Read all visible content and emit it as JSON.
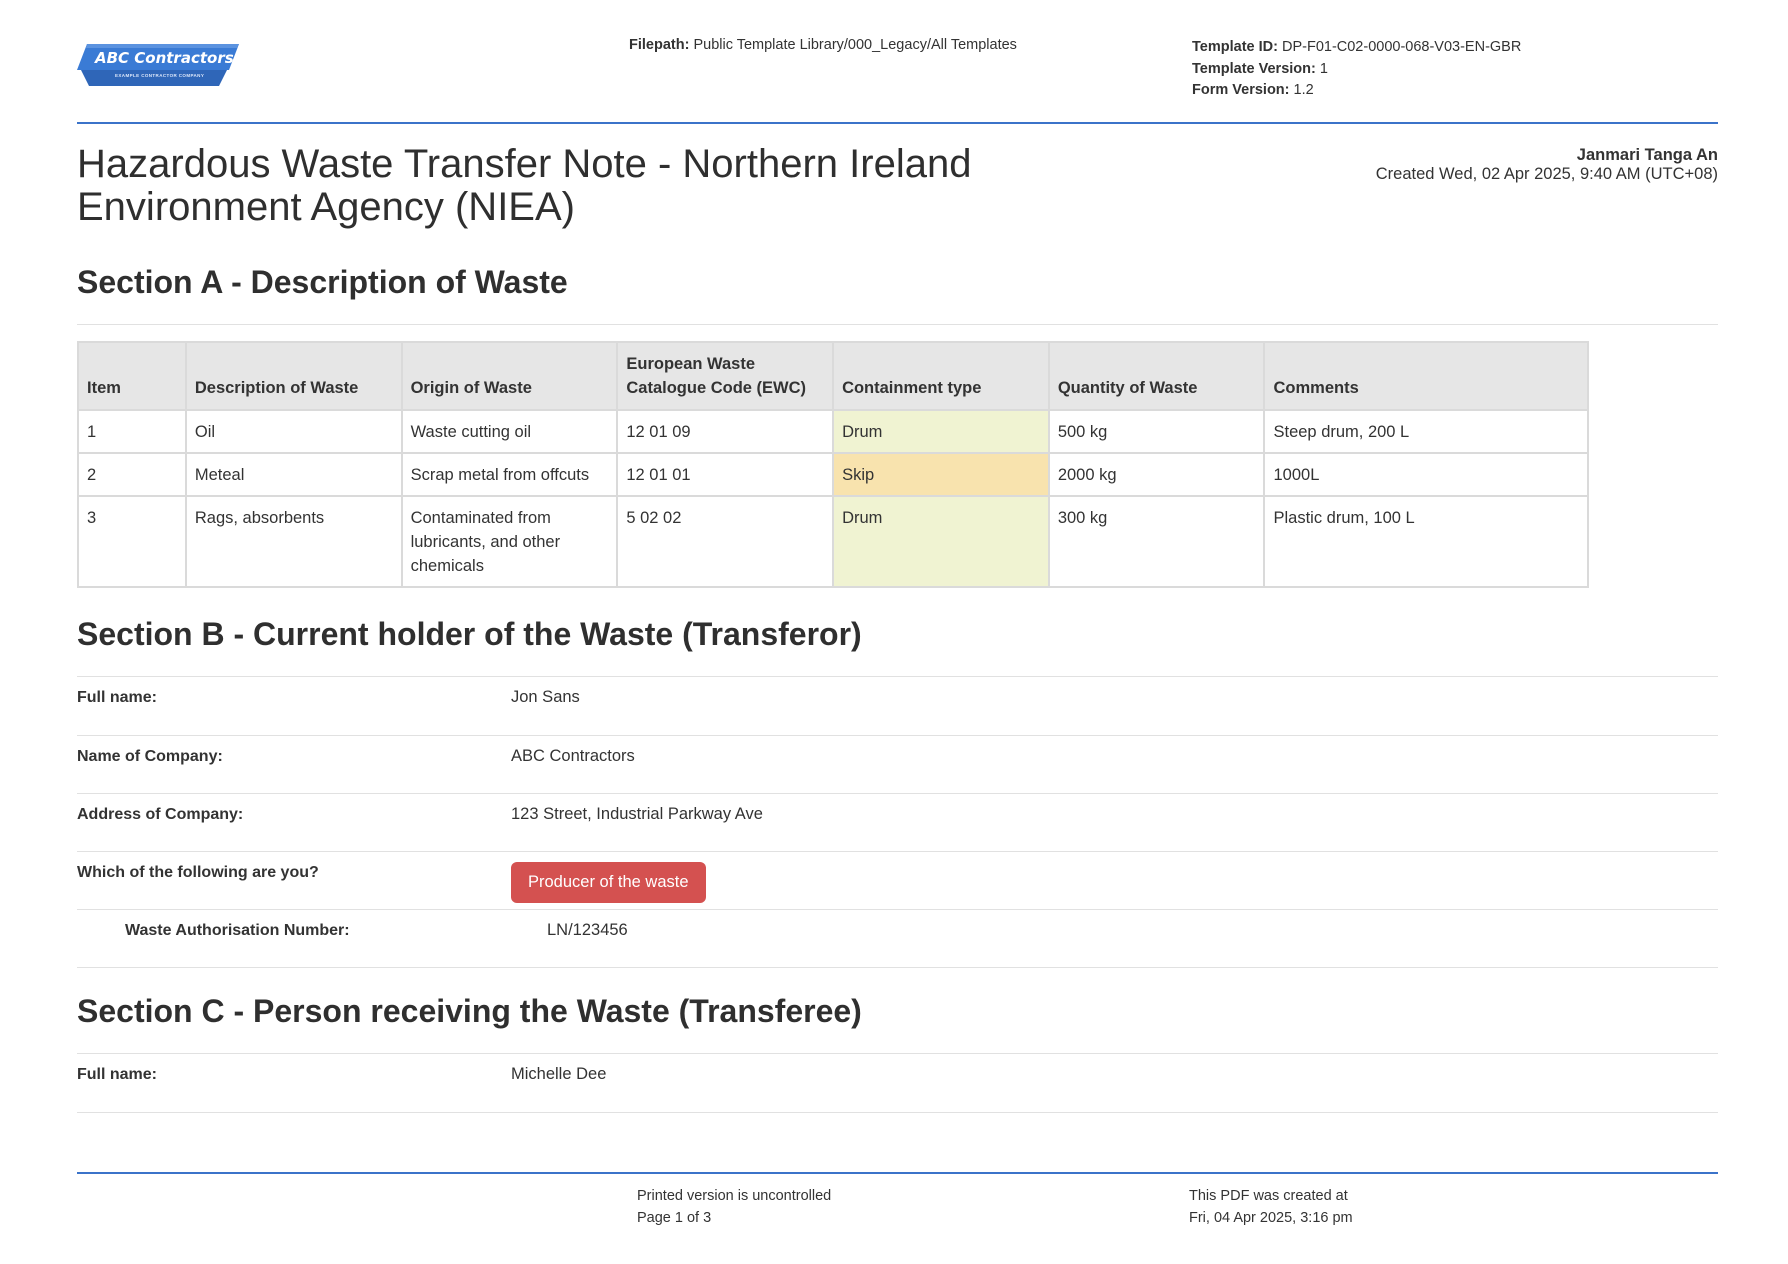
{
  "header": {
    "logo": {
      "name": "ABC Contractors",
      "tagline": "EXAMPLE CONTRACTOR COMPANY",
      "color": "#3a7bd5"
    },
    "filepath_label": "Filepath:",
    "filepath_value": "Public Template Library/000_Legacy/All Templates",
    "template_id_label": "Template ID:",
    "template_id_value": "DP-F01-C02-0000-068-V03-EN-GBR",
    "template_version_label": "Template Version:",
    "template_version_value": "1",
    "form_version_label": "Form Version:",
    "form_version_value": "1.2"
  },
  "document": {
    "title_line1": "Hazardous Waste Transfer Note - Northern Ireland",
    "title_line2": "Environment Agency (NIEA)",
    "author": "Janmari Tanga An",
    "created": "Created Wed, 02 Apr 2025, 9:40 AM (UTC+08)"
  },
  "section_a": {
    "title": "Section A - Description of Waste",
    "columns": [
      "Item",
      "Description of Waste",
      "Origin of Waste",
      "European Waste Catalogue Code (EWC)",
      "Containment type",
      "Quantity of Waste",
      "Comments"
    ],
    "rows": [
      {
        "item": "1",
        "description": "Oil",
        "origin": "Waste cutting oil",
        "ewc": "12 01 09",
        "containment": "Drum",
        "quantity": "500 kg",
        "comments": "Steep drum, 200 L"
      },
      {
        "item": "2",
        "description": "Meteal",
        "origin": "Scrap metal from offcuts",
        "ewc": "12 01 01",
        "containment": "Skip",
        "quantity": "2000 kg",
        "comments": "1000L"
      },
      {
        "item": "3",
        "description": "Rags, absorbents",
        "origin": "Contaminated from lubricants, and other chemicals",
        "ewc": "5 02 02",
        "containment": "Drum",
        "quantity": "300 kg",
        "comments": "Plastic drum, 100 L"
      }
    ],
    "containment_colors": {
      "Drum": "#f0f3d2",
      "Skip": "#f8e3ae"
    }
  },
  "section_b": {
    "title": "Section B - Current holder of the Waste (Transferor)",
    "full_name_label": "Full name:",
    "full_name_value": "Jon Sans",
    "company_label": "Name of Company:",
    "company_value": "ABC Contractors",
    "address_label": "Address of Company:",
    "address_value": "123 Street, Industrial Parkway Ave",
    "role_label": "Which of the following are you?",
    "role_value": "Producer of the waste",
    "role_color": "#d45150",
    "auth_label": "Waste Authorisation Number:",
    "auth_value": "LN/123456"
  },
  "section_c": {
    "title": "Section C - Person receiving the Waste (Transferee)",
    "full_name_label": "Full name:",
    "full_name_value": "Michelle Dee"
  },
  "footer": {
    "uncontrolled": "Printed version is uncontrolled",
    "page": "Page 1 of 3",
    "pdf_created_label": "This PDF was created at",
    "pdf_created_value": "Fri, 04 Apr 2025, 3:16 pm"
  }
}
